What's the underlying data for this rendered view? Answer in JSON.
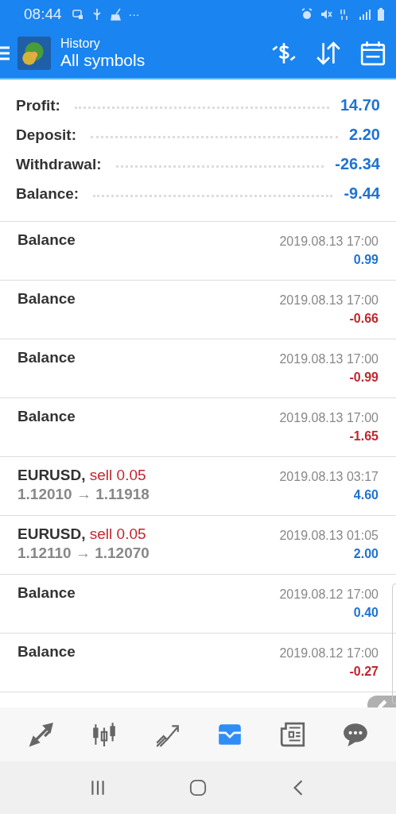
{
  "status_bar": {
    "time": "08:44",
    "extra": "···"
  },
  "toolbar": {
    "title": "History",
    "subtitle": "All symbols"
  },
  "summary": [
    {
      "label": "Profit:",
      "value": "14.70"
    },
    {
      "label": "Deposit:",
      "value": "2.20"
    },
    {
      "label": "Withdrawal:",
      "value": "-26.34"
    },
    {
      "label": "Balance:",
      "value": "-9.44"
    }
  ],
  "deals": [
    {
      "kind": "balance",
      "title": "Balance",
      "time": "2019.08.13 17:00",
      "amount": "0.99",
      "loss": false
    },
    {
      "kind": "balance",
      "title": "Balance",
      "time": "2019.08.13 17:00",
      "amount": "-0.66",
      "loss": true
    },
    {
      "kind": "balance",
      "title": "Balance",
      "time": "2019.08.13 17:00",
      "amount": "-0.99",
      "loss": true
    },
    {
      "kind": "balance",
      "title": "Balance",
      "time": "2019.08.13 17:00",
      "amount": "-1.65",
      "loss": true
    },
    {
      "kind": "trade",
      "symbol": "EURUSD,",
      "order": "sell 0.05",
      "prices": "1.12010 → 1.11918",
      "time": "2019.08.13 03:17",
      "amount": "4.60",
      "loss": false
    },
    {
      "kind": "trade",
      "symbol": "EURUSD,",
      "order": "sell 0.05",
      "prices": "1.12110 → 1.12070",
      "time": "2019.08.13 01:05",
      "amount": "2.00",
      "loss": false
    },
    {
      "kind": "balance",
      "title": "Balance",
      "time": "2019.08.12 17:00",
      "amount": "0.40",
      "loss": false
    },
    {
      "kind": "balance",
      "title": "Balance",
      "time": "2019.08.12 17:00",
      "amount": "-0.27",
      "loss": true
    }
  ],
  "bottom_tabs": [
    {
      "selected": false
    },
    {
      "selected": false
    },
    {
      "selected": false
    },
    {
      "selected": true
    },
    {
      "selected": false
    },
    {
      "selected": false
    }
  ]
}
